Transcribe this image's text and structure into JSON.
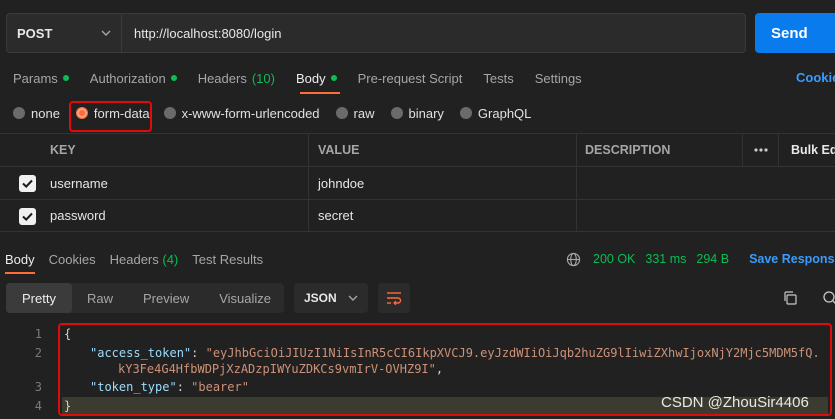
{
  "request": {
    "method": "POST",
    "url": "http://localhost:8080/login",
    "send_label": "Send"
  },
  "request_tabs": [
    {
      "label": "Params",
      "indicator": "dot"
    },
    {
      "label": "Authorization",
      "indicator": "dot"
    },
    {
      "label": "Headers",
      "indicator": "count",
      "count": "(10)"
    },
    {
      "label": "Body",
      "indicator": "dot",
      "active": true
    },
    {
      "label": "Pre-request Script"
    },
    {
      "label": "Tests"
    },
    {
      "label": "Settings"
    }
  ],
  "cookies_link": "Cookie",
  "body_types": [
    {
      "label": "none"
    },
    {
      "label": "form-data",
      "selected": true
    },
    {
      "label": "x-www-form-urlencoded"
    },
    {
      "label": "raw"
    },
    {
      "label": "binary"
    },
    {
      "label": "GraphQL"
    }
  ],
  "table": {
    "headers": {
      "key": "KEY",
      "value": "VALUE",
      "description": "DESCRIPTION",
      "more": "ooo",
      "bulk_edit": "Bulk Edi"
    },
    "rows": [
      {
        "checked": true,
        "key": "username",
        "value": "johndoe",
        "description": ""
      },
      {
        "checked": true,
        "key": "password",
        "value": "secret",
        "description": ""
      }
    ]
  },
  "response_tabs": [
    {
      "label": "Body",
      "active": true
    },
    {
      "label": "Cookies"
    },
    {
      "label": "Headers",
      "count": "(4)"
    },
    {
      "label": "Test Results"
    }
  ],
  "status": {
    "code": "200 OK",
    "time": "331 ms",
    "size": "294 B",
    "save_label": "Save Response"
  },
  "view_modes": [
    "Pretty",
    "Raw",
    "Preview",
    "Visualize"
  ],
  "format_select": "JSON",
  "code_lines": {
    "l1": "{",
    "l2_key": "\"access_token\"",
    "l2_val": "\"eyJhbGciOiJIUzI1NiIsInR5cCI6IkpXVCJ9.eyJzdWIiOiJqb2huZG9lIiwiZXhwIjoxNjY2Mjc5MDM5fQ.",
    "l2_cont": "kY3Fe4G4HfbWDPjXzADzpIWYuZDKCs9vmIrV-OVHZ9I\"",
    "l3_key": "\"token_type\"",
    "l3_val": "\"bearer\"",
    "l4": "}"
  },
  "line_numbers": [
    "1",
    "2",
    "3",
    "4"
  ],
  "watermark": "CSDN @ZhouSir4406",
  "colors": {
    "accent": "#ff6c37",
    "send": "#097bed",
    "green": "#0cbb52",
    "link": "#3a9bfd",
    "highlight": "#e00b0b"
  }
}
